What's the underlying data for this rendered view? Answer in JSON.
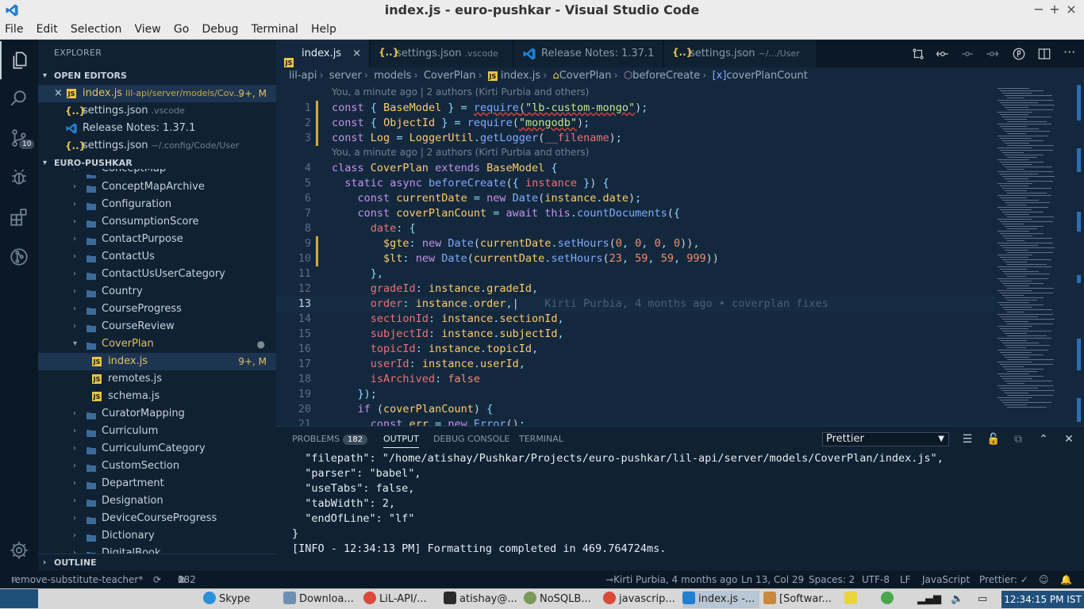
{
  "window": {
    "title": "index.js - euro-pushkar - Visual Studio Code",
    "minimize": "−",
    "maximize": "+",
    "close": "×"
  },
  "menu": [
    "File",
    "Edit",
    "Selection",
    "View",
    "Go",
    "Debug",
    "Terminal",
    "Help"
  ],
  "activity": {
    "scm_badge": "10"
  },
  "sidebar": {
    "header": "EXPLORER",
    "open_editors": {
      "title": "OPEN EDITORS",
      "items": [
        {
          "name": "index.js",
          "desc": "lil-api/server/models/Cov...",
          "meta": "9+, M"
        },
        {
          "name": "settings.json",
          "desc": ".vscode",
          "meta": ""
        },
        {
          "name": "Release Notes: 1.37.1",
          "desc": "",
          "meta": ""
        },
        {
          "name": "settings.json",
          "desc": "~/.config/Code/User",
          "meta": ""
        }
      ]
    },
    "project": {
      "title": "EURO-PUSHKAR",
      "partial_top": "ConceptMap",
      "folders": [
        "ConceptMapArchive",
        "Configuration",
        "ConsumptionScore",
        "ContactPurpose",
        "ContactUs",
        "ContactUsUserCategory",
        "Country",
        "CourseProgress",
        "CourseReview"
      ],
      "open_folder": "CoverPlan",
      "files": [
        {
          "name": "index.js",
          "meta": "9+, M"
        },
        {
          "name": "remotes.js",
          "meta": ""
        },
        {
          "name": "schema.js",
          "meta": ""
        }
      ],
      "folders_after": [
        "CuratorMapping",
        "Curriculum",
        "CurriculumCategory",
        "CustomSection",
        "Department",
        "Designation",
        "DeviceCourseProgress",
        "Dictionary"
      ],
      "partial_bottom": "DigitalBook"
    },
    "outline": "OUTLINE"
  },
  "tabs": [
    {
      "label": "index.js",
      "desc": "",
      "close": "×"
    },
    {
      "label": "settings.json",
      "desc": ".vscode"
    },
    {
      "label": "Release Notes: 1.37.1",
      "desc": ""
    },
    {
      "label": "settings.json",
      "desc": "~/.../User"
    }
  ],
  "breadcrumb": [
    "lil-api",
    "server",
    "models",
    "CoverPlan",
    "index.js",
    "CoverPlan",
    "beforeCreate",
    "coverPlanCount"
  ],
  "editor": {
    "codelens1": "You, a minute ago | 2 authors (Kirti Purbia and others)",
    "codelens2": "You, a minute ago | 2 authors (Kirti Purbia and others)",
    "blame": "Kirti Purbia, 4 months ago • coverplan fixes",
    "line_numbers": [
      "1",
      "2",
      "3",
      "4",
      "5",
      "6",
      "7",
      "8",
      "9",
      "10",
      "11",
      "12",
      "13",
      "14",
      "15",
      "16",
      "17",
      "18",
      "19",
      "20",
      "21"
    ]
  },
  "panel": {
    "tabs": [
      {
        "label": "PROBLEMS",
        "badge": "182"
      },
      {
        "label": "OUTPUT"
      },
      {
        "label": "DEBUG CONSOLE"
      },
      {
        "label": "TERMINAL"
      }
    ],
    "selected_channel": "Prettier",
    "output": [
      "  \"filepath\": \"/home/atishay/Pushkar/Projects/euro-pushkar/lil-api/server/models/CoverPlan/index.js\",",
      "  \"parser\": \"babel\",",
      "  \"useTabs\": false,",
      "  \"tabWidth\": 2,",
      "  \"endOfLine\": \"lf\"",
      "}",
      "[INFO - 12:34:13 PM] Formatting completed in 469.764724ms."
    ]
  },
  "statusbar": {
    "branch": "remove-substitute-teacher*",
    "errors": "182",
    "warnings": "0",
    "blame": "Kirti Purbia, 4 months ago",
    "position": "Ln 13, Col 29",
    "spaces": "Spaces: 2",
    "encoding": "UTF-8",
    "eol": "LF",
    "language": "JavaScript",
    "prettier": "Prettier: ✓"
  },
  "taskbar": {
    "items": [
      "Skype",
      "Downloa...",
      "LiL-API/...",
      "atishay@...",
      "NoSQLB...",
      "javascrip...",
      "index.js -...",
      "[Softwar..."
    ],
    "clock": "12:34:15 PM IST"
  },
  "colors": {
    "accent": "#2a6fb5",
    "background": "#13283d",
    "sidebar": "#0f2133"
  }
}
